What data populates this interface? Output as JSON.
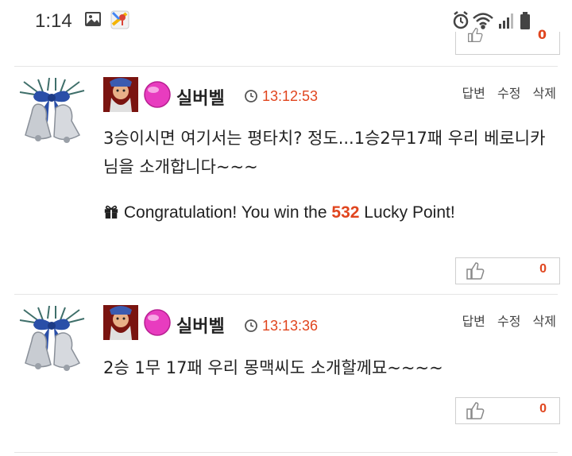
{
  "status_bar": {
    "time": "1:14",
    "icons": [
      "gallery-icon",
      "maps-icon",
      "alarm-icon",
      "wifi-icon",
      "signal-icon",
      "battery-icon"
    ]
  },
  "colors": {
    "accent": "#e0451e"
  },
  "comments": [
    {
      "nickname": "실버벨",
      "time": "13:12:53",
      "actions": {
        "reply": "답변",
        "edit": "수정",
        "delete": "삭제"
      },
      "body": "3승이시면 여기서는 평타치? 정도...1승2무17패 우리 베로니카님을 소개합니다~~~",
      "lucky": {
        "prefix": "Congratulation! You win the",
        "points": "532",
        "suffix": "Lucky Point!"
      },
      "likes": "0"
    },
    {
      "nickname": "실버벨",
      "time": "13:13:36",
      "actions": {
        "reply": "답변",
        "edit": "수정",
        "delete": "삭제"
      },
      "body": "2승 1무 17패 우리 몽맥씨도 소개할께묘~~~~",
      "likes": "0"
    }
  ],
  "top_partial_likes": "0"
}
